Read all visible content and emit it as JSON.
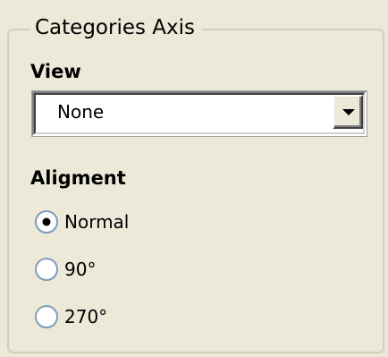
{
  "group": {
    "title": "Categories Axis"
  },
  "view": {
    "label": "View",
    "selected": "None",
    "dropdown_icon": "chevron-down-icon"
  },
  "alignment": {
    "label": "Aligment",
    "options": [
      {
        "label": "Normal",
        "checked": true
      },
      {
        "label": "90°",
        "checked": false
      },
      {
        "label": "270°",
        "checked": false
      }
    ]
  }
}
